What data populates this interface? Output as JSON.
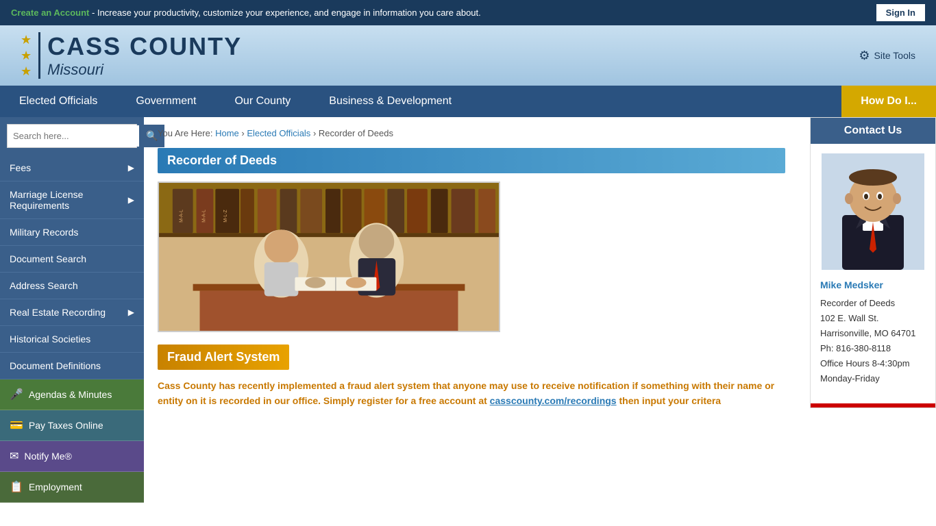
{
  "topbar": {
    "create_account_label": "Create an Account",
    "tagline": " - Increase your productivity, customize your experience, and engage in information you care about.",
    "sign_in_label": "Sign In"
  },
  "header": {
    "logo_county": "CASS COUNTY",
    "logo_state": "Missouri",
    "site_tools_label": "Site Tools",
    "stars": [
      "★",
      "★",
      "★"
    ]
  },
  "nav": {
    "items": [
      {
        "label": "Elected Officials",
        "href": "#"
      },
      {
        "label": "Government",
        "href": "#"
      },
      {
        "label": "Our County",
        "href": "#"
      },
      {
        "label": "Business & Development",
        "href": "#"
      },
      {
        "label": "How Do I...",
        "href": "#",
        "highlight": true
      }
    ]
  },
  "sidebar": {
    "search_placeholder": "Search here...",
    "menu_items": [
      {
        "label": "Fees",
        "has_arrow": true
      },
      {
        "label": "Marriage License Requirements",
        "has_arrow": true
      },
      {
        "label": "Military Records",
        "has_arrow": false
      },
      {
        "label": "Document Search",
        "has_arrow": false
      },
      {
        "label": "Address Search",
        "has_arrow": false
      },
      {
        "label": "Real Estate Recording",
        "has_arrow": true
      },
      {
        "label": "Historical Societies",
        "has_arrow": false
      },
      {
        "label": "Document Definitions",
        "has_arrow": false
      }
    ],
    "quick_links": [
      {
        "label": "Agendas & Minutes",
        "icon": "🎤"
      },
      {
        "label": "Pay Taxes Online",
        "icon": "💳"
      },
      {
        "label": "Notify Me®",
        "icon": "✉"
      },
      {
        "label": "Employment",
        "icon": "📋"
      }
    ]
  },
  "breadcrumb": {
    "prefix": "You Are Here: ",
    "home": "Home",
    "elected": "Elected Officials",
    "current": "Recorder of Deeds"
  },
  "main": {
    "page_title": "Recorder of Deeds",
    "fraud_title": "Fraud Alert System",
    "fraud_text": "Cass County has recently implemented a fraud alert system that anyone may use to receive notification if something with their name or entity on it is recorded in our office.  Simply register for a free account at ",
    "fraud_link": "casscounty.com/recordings",
    "fraud_text2": " then input your critera"
  },
  "contact": {
    "title": "Contact Us",
    "name": "Mike Medsker",
    "title_role": "Recorder of Deeds",
    "address1": "102 E. Wall St.",
    "address2": "Harrisonville, MO 64701",
    "phone": "Ph: 816-380-8118",
    "hours": " Office Hours 8-4:30pm",
    "days": "Monday-Friday"
  }
}
